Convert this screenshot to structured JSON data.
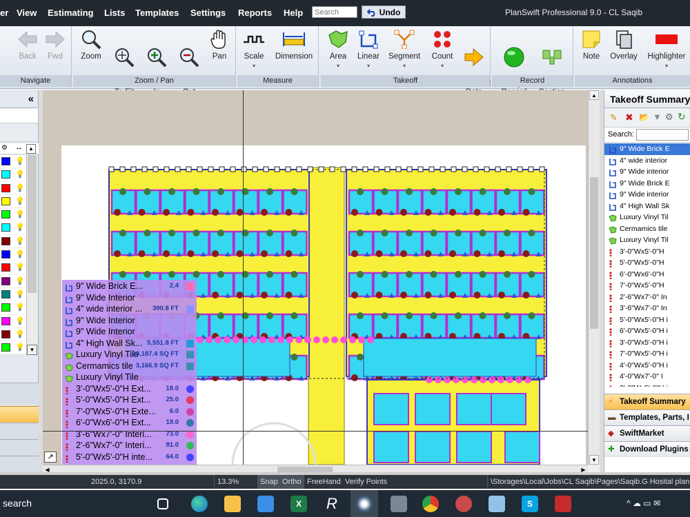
{
  "menu": {
    "items": [
      "er",
      "View",
      "Estimating",
      "Lists",
      "Templates",
      "Settings",
      "Reports",
      "Help"
    ],
    "search_placeholder": "Search",
    "undo_label": "Undo",
    "app_title": "PlanSwift Professional 9.0 - CL Saqib"
  },
  "ribbon": {
    "groups": [
      {
        "label": "Navigate",
        "buttons": [
          {
            "label": "Back"
          },
          {
            "label": "Fwd"
          }
        ]
      },
      {
        "label": "Zoom / Pan",
        "buttons": [
          {
            "label": "Zoom"
          },
          {
            "label": "Zoom\nTo Fit"
          },
          {
            "label": "Zoom\nIn"
          },
          {
            "label": "Zoom\nOut"
          },
          {
            "label": "Pan"
          }
        ]
      },
      {
        "label": "Measure",
        "buttons": [
          {
            "label": "Scale"
          },
          {
            "label": "Dimension"
          }
        ]
      },
      {
        "label": "Takeoff",
        "buttons": [
          {
            "label": "Area"
          },
          {
            "label": "Linear"
          },
          {
            "label": "Segment"
          },
          {
            "label": "Count"
          },
          {
            "label": "Send\nData"
          }
        ]
      },
      {
        "label": "Record",
        "buttons": [
          {
            "label": "Digitizer\nRecord"
          },
          {
            "label": "New\nSection"
          }
        ]
      },
      {
        "label": "Annotations",
        "buttons": [
          {
            "label": "Note"
          },
          {
            "label": "Overlay"
          },
          {
            "label": "Highlighter"
          }
        ]
      }
    ]
  },
  "left_panel": {
    "collapse_glyph": "«",
    "layer_colors": [
      "#0000ff",
      "#00ffff",
      "#ff0000",
      "#ffff00",
      "#00ff00",
      "#00ffff",
      "#800000",
      "#0000ff",
      "#ff0000",
      "#800080",
      "#008080",
      "#00ff00",
      "#ff00ff",
      "#800000",
      "#00ff00"
    ]
  },
  "overlay_items": [
    {
      "label": "9\" Wide Brick E...",
      "value": "2,4",
      "icon": "linear",
      "swatch": "#ff69b4"
    },
    {
      "label": "9\" Wide Interior",
      "value": "",
      "icon": "linear",
      "swatch": ""
    },
    {
      "label": "4\" wide interior ...",
      "value": "390.8 FT",
      "icon": "linear",
      "swatch": "#8a8fff"
    },
    {
      "label": "9\" Wide Interior",
      "value": "",
      "icon": "linear",
      "swatch": ""
    },
    {
      "label": "9\" Wide Interior",
      "value": "",
      "icon": "linear",
      "swatch": ""
    },
    {
      "label": "4\" High Wall Sk...",
      "value": "5,551.8 FT",
      "icon": "linear",
      "swatch": "#2299dd"
    },
    {
      "label": "Luxury Vinyl Tile",
      "value": "28,187.4 SQ FT",
      "icon": "area",
      "swatch": "#3a8fb0"
    },
    {
      "label": "Cermamics tile",
      "value": "3,166.9 SQ FT",
      "icon": "area",
      "swatch": "#3a8fb0"
    },
    {
      "label": "Luxury Vinyl Tile",
      "value": "",
      "icon": "area",
      "swatch": ""
    },
    {
      "label": "3'-0\"Wx5'-0\"H Ext...",
      "value": "18.0",
      "icon": "count",
      "swatch": "#4444ff"
    },
    {
      "label": "5'-0\"Wx5'-0\"H Ext...",
      "value": "25.0",
      "icon": "count",
      "swatch": "#e83b5a"
    },
    {
      "label": "7'-0\"Wx5'-0\"H Exte...",
      "value": "6.0",
      "icon": "count",
      "swatch": "#cc44aa"
    },
    {
      "label": "6'-0\"Wx6'-0\"H Ext...",
      "value": "19.0",
      "icon": "count",
      "swatch": "#3377aa"
    },
    {
      "label": "3'-6\"Wx7'-0\" Interi...",
      "value": "73.0",
      "icon": "count",
      "swatch": "#ff66cc"
    },
    {
      "label": "2'-6\"Wx7'-0\" Interi...",
      "value": "81.0",
      "icon": "count",
      "swatch": "#33bb55"
    },
    {
      "label": "5'-0\"Wx5'-0\"H inte...",
      "value": "64.0",
      "icon": "count",
      "swatch": "#4444ff"
    }
  ],
  "right_panel": {
    "title": "Takeoff Summary",
    "search_label": "Search:",
    "items": [
      {
        "label": "9\" Wide Brick E",
        "icon": "linear",
        "selected": true
      },
      {
        "label": "4\" wide interior",
        "icon": "linear"
      },
      {
        "label": "9\" Wide interior",
        "icon": "linear"
      },
      {
        "label": "9\" Wide Brick E",
        "icon": "linear"
      },
      {
        "label": "9\" Wide interior",
        "icon": "linear"
      },
      {
        "label": "4\" High Wall Sk",
        "icon": "linear"
      },
      {
        "label": "Luxury Vinyl Til",
        "icon": "area"
      },
      {
        "label": "Cermamics tile",
        "icon": "area"
      },
      {
        "label": "Luxury Vinyl Til",
        "icon": "area"
      },
      {
        "label": "3'-0\"Wx5'-0\"H",
        "icon": "count"
      },
      {
        "label": "5'-0\"Wx5'-0\"H",
        "icon": "count"
      },
      {
        "label": "6'-0\"Wx6'-0\"H",
        "icon": "count"
      },
      {
        "label": "7'-0\"Wx5'-0\"H",
        "icon": "count"
      },
      {
        "label": "2'-6\"Wx7'-0\" In",
        "icon": "count"
      },
      {
        "label": "3'-6\"Wx7'-0\" In",
        "icon": "count"
      },
      {
        "label": "5'-0\"Wx5'-0\"H i",
        "icon": "count"
      },
      {
        "label": "6'-0\"Wx5'-0\"H i",
        "icon": "count"
      },
      {
        "label": "3'-0\"Wx5'-0\"H i",
        "icon": "count"
      },
      {
        "label": "7'-0\"Wx5'-0\"H i",
        "icon": "count"
      },
      {
        "label": "4'-0\"Wx5'-0\"H i",
        "icon": "count"
      },
      {
        "label": "4'-0\"Wx7'-0\" I",
        "icon": "count"
      },
      {
        "label": "3'-0\"Wx5'-0\"H i",
        "icon": "count"
      }
    ],
    "accordion": [
      "Takeoff Summary",
      "Templates, Parts, I",
      "SwiftMarket",
      "Download Plugins"
    ]
  },
  "status": {
    "coords": "2025.0, 3170.9",
    "zoom": "13.3%",
    "snap": "Snap",
    "ortho": "Ortho",
    "freehand": "FreeHand",
    "verify": "Verify Points",
    "path": "\\Storages\\Local\\Jobs\\CL Saqib\\Pages\\Saqib.G Hosital plan (1)"
  },
  "taskbar": {
    "search_label": "search"
  }
}
